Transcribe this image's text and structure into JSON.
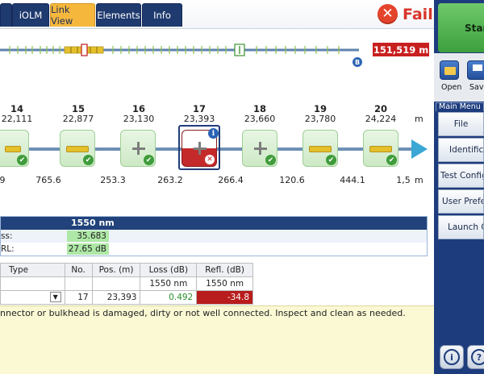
{
  "tabs": [
    {
      "label": ""
    },
    {
      "label": "iOLM"
    },
    {
      "label": "Link View"
    },
    {
      "label": "Elements"
    },
    {
      "label": "Info"
    }
  ],
  "status": {
    "text": "Fail",
    "icon": "fail-x-icon",
    "color": "#e5442c"
  },
  "overview": {
    "total_distance": "151,519 m",
    "marker_b": "B"
  },
  "events": [
    {
      "number": "14",
      "position": "22,111",
      "type": "connector",
      "status": "pass"
    },
    {
      "number": "15",
      "position": "22,877",
      "type": "connector",
      "status": "pass"
    },
    {
      "number": "16",
      "position": "23,130",
      "type": "splice",
      "status": "pass"
    },
    {
      "number": "17",
      "position": "23,393",
      "type": "connector",
      "status": "fail"
    },
    {
      "number": "18",
      "position": "23,660",
      "type": "splice",
      "status": "pass"
    },
    {
      "number": "19",
      "position": "23,780",
      "type": "connector",
      "status": "pass"
    },
    {
      "number": "20",
      "position": "24,224",
      "type": "connector",
      "status": "pass"
    }
  ],
  "unit": "m",
  "spans": [
    "9",
    "765.6",
    "253.3",
    "263.2",
    "266.4",
    "120.6",
    "444.1",
    "1,5"
  ],
  "summary": {
    "wavelength": "1550 nm",
    "rows": [
      {
        "label": "ss:",
        "value": "35.683 dB"
      },
      {
        "label": "RL:",
        "value": "27.65 dB"
      }
    ]
  },
  "table": {
    "headers": {
      "type": "Type",
      "no": "No.",
      "pos": "Pos. (m)",
      "loss": "Loss (dB)",
      "refl": "Refl. (dB)"
    },
    "subheaders": {
      "loss": "1550 nm",
      "refl": "1550 nm"
    },
    "row": {
      "type": "",
      "no": "17",
      "pos": "23,393",
      "loss": "0.492",
      "refl": "-34.8"
    }
  },
  "diagnosis": "nnector or bulkhead is damaged, dirty or not well connected. Inspect and clean as needed.",
  "right_panel": {
    "start_label": "Start",
    "open_label": "Open",
    "save_label": "Save",
    "menu_title": "Main Menu",
    "menu_items": [
      "File",
      "Identification",
      "Test Configurator",
      "User Preferences",
      "Launch OTDR"
    ]
  },
  "colors": {
    "navy": "#1d3c7d",
    "accent_tab": "#f5b83d",
    "fail_red": "#c81f1f",
    "pass_green": "#3f9c3a"
  }
}
